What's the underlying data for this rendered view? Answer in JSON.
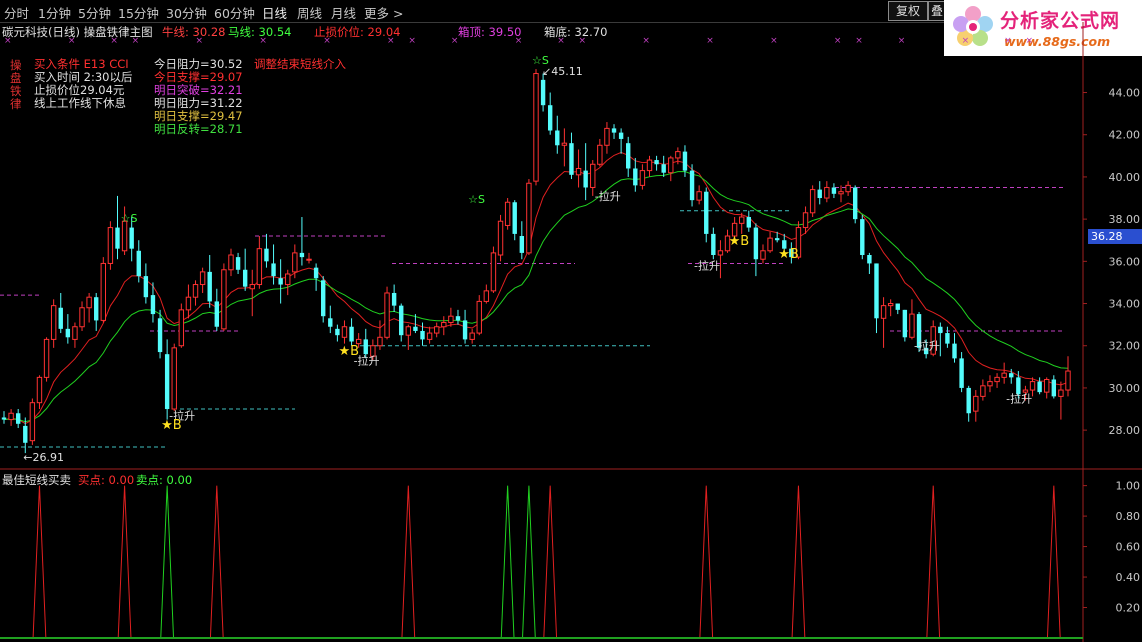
{
  "toolbar": {
    "timeframes": [
      "分时",
      "1分钟",
      "5分钟",
      "15分钟",
      "30分钟",
      "60分钟",
      "日线",
      "周线",
      "月线",
      "更多 >"
    ],
    "active_timeframe": "日线",
    "fuquan_label": "复权",
    "fuquan2_label": "叠"
  },
  "logo": {
    "text": "分析家公式网",
    "url": "www.88gs.com"
  },
  "header": {
    "title": "碳元科技(日线) 操盘铁律主图",
    "niuxian": "牛线: 30.28",
    "maxian": "马线: 30.54",
    "stoploss": "止损价位: 29.04",
    "box_top": "箱顶: 39.50",
    "box_bottom": "箱底: 32.70"
  },
  "side_label": [
    "操",
    "盘",
    "铁",
    "律"
  ],
  "info_left": {
    "buy_cond": "买入条件 E13 CCI",
    "buy_time": "买入时间 2:30以后",
    "stop_price": "止损价位29.04元",
    "rest_note": "线上工作线下休息"
  },
  "info_mid": {
    "resist_today": "今日阻力=30.52",
    "support_today": "今日支撑=29.07",
    "break_tomorrow": "明日突破=32.21",
    "resist_tomorrow": "明日阻力=31.22",
    "support_tomorrow": "明日支撑=29.47",
    "reverse_tomorrow": "明日反转=28.71"
  },
  "adjust_note": "调整结束短线介入",
  "price_tag": "36.28",
  "max_label": "45.11",
  "min_label": "26.91",
  "lasheng": "拉升",
  "b_label": "B",
  "s_label": "S",
  "colors": {
    "up": "#ff3232",
    "down": "#54fcfc",
    "ma_fast": "#e02020",
    "ma_slow": "#20d020",
    "bg": "#000000"
  },
  "chart_data": [
    {
      "type": "candlestick",
      "title": "碳元科技(日线)",
      "ylim": [
        26.3,
        46.3
      ],
      "y_ticks": [
        28.0,
        30.0,
        32.0,
        34.0,
        36.0,
        38.0,
        40.0,
        42.0,
        44.0
      ],
      "ohlc": [
        [
          28.6,
          28.9,
          28.3,
          28.5
        ],
        [
          28.5,
          29.0,
          28.2,
          28.8
        ],
        [
          28.8,
          29.0,
          28.1,
          28.3
        ],
        [
          28.2,
          28.6,
          26.91,
          27.4
        ],
        [
          27.5,
          29.5,
          27.3,
          29.3
        ],
        [
          29.3,
          30.6,
          29.0,
          30.5
        ],
        [
          30.5,
          32.4,
          30.3,
          32.3
        ],
        [
          32.3,
          34.2,
          31.9,
          33.9
        ],
        [
          33.8,
          34.5,
          32.6,
          32.8
        ],
        [
          32.8,
          33.5,
          32.1,
          32.4
        ],
        [
          32.3,
          33.1,
          31.9,
          32.9
        ],
        [
          32.9,
          34.1,
          32.7,
          33.8
        ],
        [
          33.8,
          34.5,
          33.1,
          34.3
        ],
        [
          34.3,
          34.5,
          32.7,
          33.2
        ],
        [
          33.2,
          36.2,
          33.1,
          35.9
        ],
        [
          35.9,
          37.9,
          35.6,
          37.6
        ],
        [
          37.6,
          39.1,
          36.1,
          36.6
        ],
        [
          36.5,
          38.6,
          36.3,
          37.9
        ],
        [
          37.6,
          38.1,
          36.0,
          36.6
        ],
        [
          36.5,
          37.0,
          35.0,
          35.3
        ],
        [
          35.3,
          35.9,
          34.0,
          34.3
        ],
        [
          34.4,
          35.0,
          33.1,
          33.5
        ],
        [
          33.3,
          33.7,
          31.4,
          31.7
        ],
        [
          31.6,
          32.3,
          28.5,
          29.0
        ],
        [
          29.0,
          32.1,
          28.9,
          31.9
        ],
        [
          32.0,
          34.0,
          31.9,
          33.7
        ],
        [
          33.7,
          34.9,
          33.3,
          34.3
        ],
        [
          34.3,
          35.1,
          33.9,
          34.9
        ],
        [
          34.9,
          35.7,
          34.5,
          35.5
        ],
        [
          35.5,
          36.3,
          33.8,
          34.1
        ],
        [
          34.1,
          34.7,
          32.7,
          32.9
        ],
        [
          32.8,
          35.9,
          32.7,
          35.6
        ],
        [
          35.6,
          36.6,
          35.3,
          36.3
        ],
        [
          36.2,
          36.4,
          35.4,
          35.6
        ],
        [
          35.6,
          36.6,
          34.6,
          34.8
        ],
        [
          34.7,
          35.6,
          33.4,
          34.9
        ],
        [
          34.9,
          37.2,
          34.7,
          36.6
        ],
        [
          36.6,
          37.3,
          35.7,
          36.0
        ],
        [
          35.9,
          36.8,
          34.9,
          35.3
        ],
        [
          35.2,
          36.1,
          34.0,
          34.9
        ],
        [
          34.9,
          35.6,
          34.4,
          35.4
        ],
        [
          35.5,
          36.8,
          35.2,
          36.4
        ],
        [
          36.4,
          38.1,
          35.8,
          36.2
        ],
        [
          36.1,
          36.4,
          35.9,
          36.1
        ],
        [
          35.7,
          35.9,
          34.6,
          35.2
        ],
        [
          35.1,
          35.3,
          33.1,
          33.4
        ],
        [
          33.3,
          33.9,
          32.6,
          32.9
        ],
        [
          32.8,
          33.0,
          32.2,
          32.5
        ],
        [
          32.4,
          33.2,
          32.1,
          32.9
        ],
        [
          32.9,
          33.3,
          32.0,
          32.2
        ],
        [
          32.1,
          32.6,
          31.9,
          32.3
        ],
        [
          32.3,
          32.8,
          31.4,
          31.6
        ],
        [
          31.5,
          32.3,
          31.3,
          32.0
        ],
        [
          32.0,
          33.2,
          31.8,
          32.4
        ],
        [
          32.4,
          34.8,
          32.3,
          34.5
        ],
        [
          34.5,
          34.9,
          33.6,
          33.9
        ],
        [
          33.9,
          34.0,
          32.2,
          32.5
        ],
        [
          32.5,
          33.0,
          31.8,
          32.9
        ],
        [
          32.9,
          33.5,
          32.6,
          32.7
        ],
        [
          32.7,
          33.1,
          32.0,
          32.3
        ],
        [
          32.3,
          32.9,
          32.1,
          32.6
        ],
        [
          32.6,
          33.1,
          32.4,
          32.9
        ],
        [
          32.9,
          33.4,
          32.5,
          33.1
        ],
        [
          33.1,
          33.8,
          32.9,
          33.4
        ],
        [
          33.4,
          33.7,
          33.0,
          33.2
        ],
        [
          33.2,
          33.7,
          32.1,
          32.3
        ],
        [
          32.3,
          32.8,
          32.1,
          32.6
        ],
        [
          32.6,
          34.4,
          32.5,
          34.1
        ],
        [
          34.1,
          34.9,
          34.0,
          34.6
        ],
        [
          34.6,
          36.7,
          34.5,
          36.4
        ],
        [
          36.3,
          38.2,
          36.0,
          37.9
        ],
        [
          37.7,
          39.0,
          37.5,
          38.8
        ],
        [
          38.8,
          38.9,
          37.0,
          37.3
        ],
        [
          37.2,
          37.9,
          36.1,
          36.4
        ],
        [
          36.4,
          39.9,
          36.3,
          39.7
        ],
        [
          39.8,
          45.11,
          39.6,
          44.9
        ],
        [
          44.6,
          44.9,
          43.1,
          43.4
        ],
        [
          43.4,
          44.0,
          42.0,
          42.2
        ],
        [
          42.2,
          42.9,
          41.1,
          41.5
        ],
        [
          41.5,
          42.3,
          40.5,
          41.6
        ],
        [
          41.6,
          42.1,
          39.9,
          40.1
        ],
        [
          40.1,
          41.3,
          39.5,
          40.4
        ],
        [
          40.3,
          41.6,
          38.9,
          39.5
        ],
        [
          39.5,
          40.8,
          39.1,
          40.6
        ],
        [
          40.6,
          41.8,
          40.5,
          41.5
        ],
        [
          41.5,
          42.6,
          41.1,
          42.3
        ],
        [
          42.3,
          42.5,
          41.8,
          42.1
        ],
        [
          42.1,
          42.3,
          41.1,
          41.8
        ],
        [
          41.6,
          41.9,
          40.0,
          40.4
        ],
        [
          40.4,
          40.9,
          39.3,
          39.6
        ],
        [
          39.6,
          40.6,
          39.4,
          40.3
        ],
        [
          40.3,
          41.0,
          40.0,
          40.8
        ],
        [
          40.8,
          41.0,
          40.3,
          40.6
        ],
        [
          40.6,
          41.0,
          40.0,
          40.2
        ],
        [
          40.2,
          41.0,
          39.8,
          40.9
        ],
        [
          40.9,
          41.4,
          40.6,
          41.2
        ],
        [
          41.2,
          41.5,
          40.0,
          40.3
        ],
        [
          40.3,
          40.6,
          38.6,
          38.9
        ],
        [
          38.9,
          39.6,
          38.7,
          39.3
        ],
        [
          39.3,
          39.5,
          36.9,
          37.3
        ],
        [
          37.3,
          37.6,
          36.1,
          36.3
        ],
        [
          36.3,
          37.0,
          35.2,
          36.5
        ],
        [
          36.5,
          37.5,
          36.4,
          37.2
        ],
        [
          37.2,
          38.1,
          37.0,
          37.8
        ],
        [
          37.8,
          38.3,
          37.3,
          38.1
        ],
        [
          38.1,
          38.4,
          37.4,
          37.6
        ],
        [
          37.6,
          37.8,
          35.3,
          36.1
        ],
        [
          36.1,
          36.8,
          35.9,
          36.5
        ],
        [
          36.5,
          37.4,
          36.4,
          37.1
        ],
        [
          37.1,
          37.4,
          36.9,
          37.0
        ],
        [
          37.0,
          37.3,
          36.5,
          36.6
        ],
        [
          36.6,
          36.9,
          35.9,
          36.2
        ],
        [
          36.2,
          37.9,
          36.1,
          37.6
        ],
        [
          37.6,
          38.6,
          37.3,
          38.3
        ],
        [
          38.3,
          39.6,
          38.1,
          39.4
        ],
        [
          39.4,
          39.8,
          38.7,
          39.0
        ],
        [
          39.0,
          39.8,
          38.8,
          39.5
        ],
        [
          39.5,
          39.7,
          39.0,
          39.2
        ],
        [
          39.2,
          39.6,
          38.8,
          39.3
        ],
        [
          39.3,
          39.8,
          39.1,
          39.6
        ],
        [
          39.5,
          39.6,
          37.8,
          38.0
        ],
        [
          38.0,
          38.2,
          36.1,
          36.3
        ],
        [
          36.3,
          36.4,
          35.4,
          35.9
        ],
        [
          35.9,
          35.9,
          32.6,
          33.3
        ],
        [
          33.3,
          34.3,
          31.9,
          33.9
        ],
        [
          33.9,
          34.2,
          33.4,
          34.0
        ],
        [
          34.0,
          34.0,
          33.5,
          33.7
        ],
        [
          33.7,
          33.7,
          32.2,
          32.4
        ],
        [
          32.4,
          34.2,
          32.3,
          33.5
        ],
        [
          33.5,
          33.6,
          31.7,
          31.9
        ],
        [
          31.9,
          32.3,
          31.4,
          31.6
        ],
        [
          31.6,
          33.2,
          31.5,
          32.9
        ],
        [
          32.9,
          33.1,
          31.5,
          32.6
        ],
        [
          32.6,
          32.9,
          31.9,
          32.1
        ],
        [
          32.1,
          32.6,
          31.2,
          31.4
        ],
        [
          31.4,
          31.7,
          29.8,
          30.0
        ],
        [
          30.0,
          30.1,
          28.4,
          28.8
        ],
        [
          28.9,
          29.9,
          28.4,
          29.6
        ],
        [
          29.6,
          30.4,
          29.4,
          30.1
        ],
        [
          30.1,
          30.6,
          29.8,
          30.3
        ],
        [
          30.3,
          30.7,
          30.0,
          30.5
        ],
        [
          30.5,
          31.2,
          30.2,
          30.7
        ],
        [
          30.7,
          30.9,
          30.2,
          30.5
        ],
        [
          30.5,
          30.8,
          29.5,
          29.7
        ],
        [
          29.8,
          30.1,
          29.4,
          29.9
        ],
        [
          29.9,
          30.5,
          29.6,
          30.3
        ],
        [
          30.3,
          30.5,
          29.7,
          29.8
        ],
        [
          29.8,
          30.5,
          29.5,
          30.4
        ],
        [
          30.4,
          30.6,
          29.5,
          29.6
        ],
        [
          29.6,
          30.3,
          28.5,
          29.9
        ],
        [
          29.9,
          31.5,
          29.6,
          30.8
        ]
      ],
      "box_top": 39.5,
      "box_bottom": 32.7
    },
    {
      "type": "line",
      "title": "最佳短线买卖",
      "series": [
        {
          "name": "买点",
          "value": "0.00"
        },
        {
          "name": "卖点",
          "value": "0.00"
        }
      ],
      "ylim": [
        0,
        1.05
      ],
      "y_ticks": [
        0.2,
        0.4,
        0.6,
        0.8,
        1.0
      ],
      "buy_spikes": [
        5,
        17,
        30,
        57,
        77,
        99,
        112,
        131,
        148
      ],
      "sell_spikes": [
        23,
        71,
        74
      ],
      "spike_value": 1.0
    }
  ]
}
